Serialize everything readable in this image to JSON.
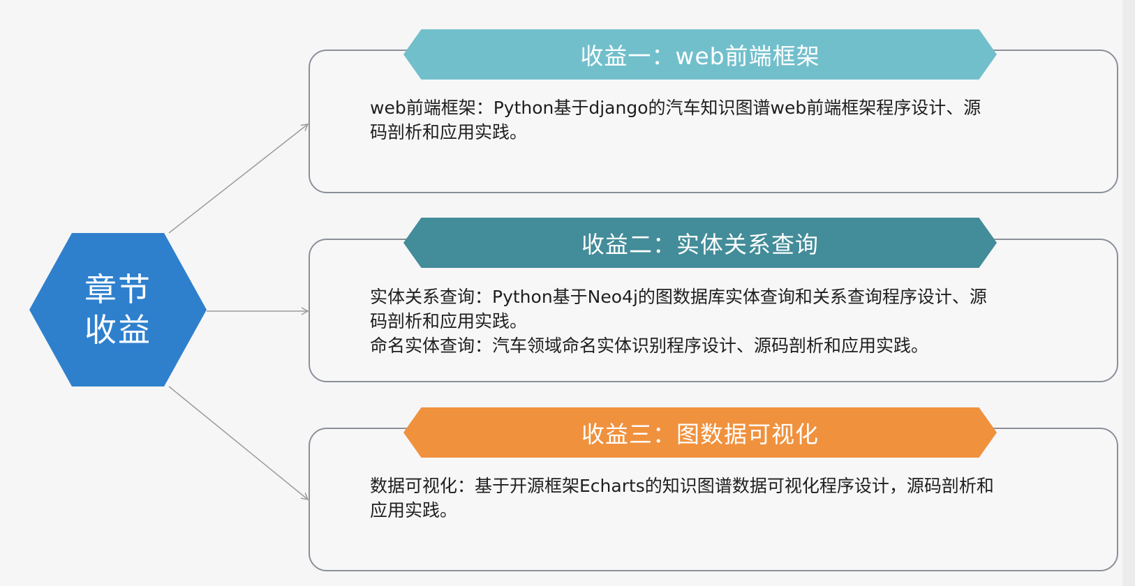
{
  "center": {
    "line1": "章节",
    "line2": "收益"
  },
  "sections": [
    {
      "title": "收益一：web前端框架",
      "lines": [
        "web前端框架：Python基于django的汽车知识图谱web前端框架程序设计、源",
        "码剖析和应用实践。"
      ]
    },
    {
      "title": "收益二：实体关系查询",
      "lines": [
        "实体关系查询：Python基于Neo4j的图数据库实体查询和关系查询程序设计、源",
        "码剖析和应用实践。",
        "命名实体查询：汽车领域命名实体识别程序设计、源码剖析和应用实践。"
      ]
    },
    {
      "title": "收益三：图数据可视化",
      "lines": [
        "数据可视化：基于开源框架Echarts的知识图谱数据可视化程序设计，源码剖析和",
        "应用实践。"
      ]
    }
  ],
  "colors": {
    "center": "#2e80cd",
    "banner1": "#72bfcc",
    "banner2": "#438c99",
    "banner3": "#f0913d",
    "connector": "#9a9a9a"
  }
}
